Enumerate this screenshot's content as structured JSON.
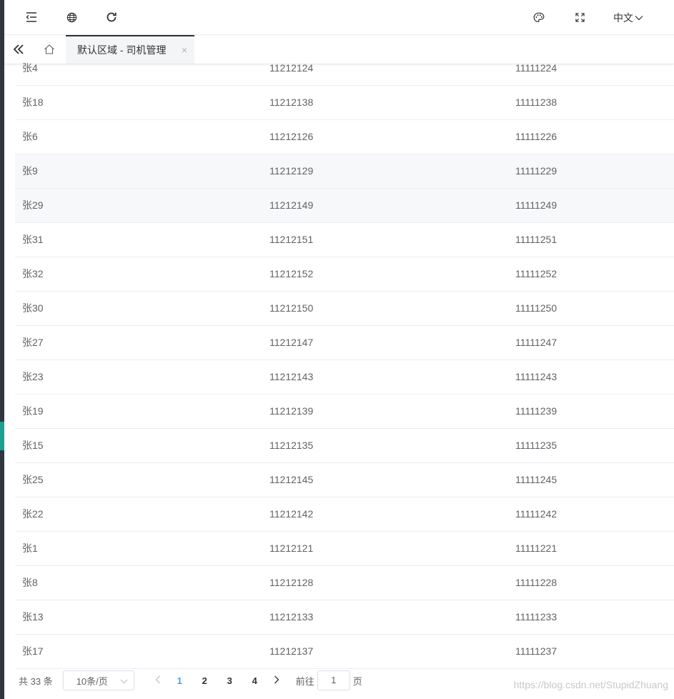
{
  "header": {
    "language": "中文",
    "icons": [
      "menu-fold-icon",
      "globe-icon",
      "refresh-icon",
      "palette-icon",
      "fullscreen-icon"
    ]
  },
  "tabs": {
    "active_label": "默认区域 - 司机管理"
  },
  "table": {
    "rows": [
      {
        "name": "张4",
        "col2": "11212124",
        "col3": "11111224"
      },
      {
        "name": "张18",
        "col2": "11212138",
        "col3": "11111238"
      },
      {
        "name": "张6",
        "col2": "11212126",
        "col3": "11111226"
      },
      {
        "name": "张9",
        "col2": "11212129",
        "col3": "11111229"
      },
      {
        "name": "张29",
        "col2": "11212149",
        "col3": "11111249"
      },
      {
        "name": "张31",
        "col2": "11212151",
        "col3": "11111251"
      },
      {
        "name": "张32",
        "col2": "11212152",
        "col3": "11111252"
      },
      {
        "name": "张30",
        "col2": "11212150",
        "col3": "11111250"
      },
      {
        "name": "张27",
        "col2": "11212147",
        "col3": "11111247"
      },
      {
        "name": "张23",
        "col2": "11212143",
        "col3": "11111243"
      },
      {
        "name": "张19",
        "col2": "11212139",
        "col3": "11111239"
      },
      {
        "name": "张15",
        "col2": "11212135",
        "col3": "11111235"
      },
      {
        "name": "张25",
        "col2": "11212145",
        "col3": "11111245"
      },
      {
        "name": "张22",
        "col2": "11212142",
        "col3": "11111242"
      },
      {
        "name": "张1",
        "col2": "11212121",
        "col3": "11111221"
      },
      {
        "name": "张8",
        "col2": "11212128",
        "col3": "11111228"
      },
      {
        "name": "张13",
        "col2": "11212133",
        "col3": "11111233"
      },
      {
        "name": "张17",
        "col2": "11212137",
        "col3": "11111237"
      }
    ]
  },
  "pagination": {
    "total": "共 33 条",
    "page_size": "10条/页",
    "pages": [
      "1",
      "2",
      "3",
      "4"
    ],
    "current": "1",
    "goto_prefix": "前往",
    "goto_value": "1",
    "goto_suffix": "页"
  },
  "watermark": "https://blog.csdn.net/StupidZhuang",
  "colors": {
    "accent": "#409eff",
    "sidebar": "#2f3541",
    "sidebar_active": "#1aa093"
  }
}
